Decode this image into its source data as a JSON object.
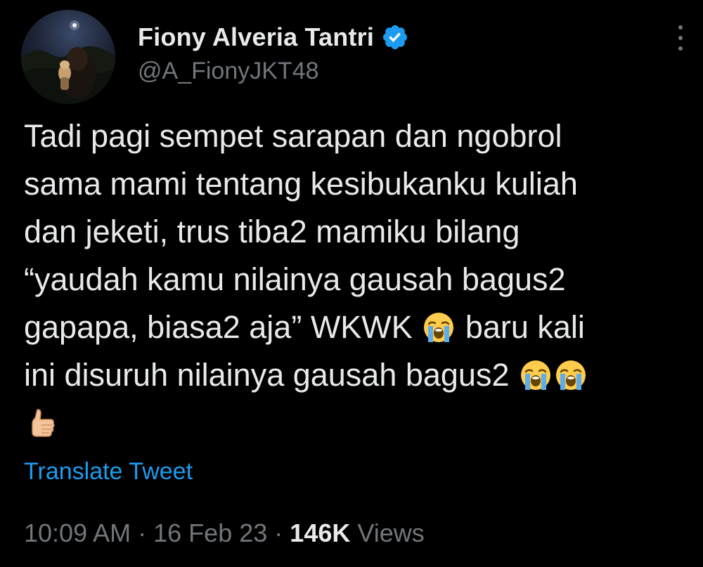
{
  "author": {
    "display_name": "Fiony Alveria Tantri",
    "handle": "@A_FionyJKT48",
    "verified_icon": "verified-badge-icon",
    "avatar_icon": "avatar-photo"
  },
  "tweet": {
    "lines": [
      "Tadi pagi sempet sarapan dan ngobrol",
      "sama mami tentang kesibukanku kuliah",
      "dan jeketi, trus tiba2 mamiku bilang",
      "“yaudah kamu nilainya gausah bagus2",
      "gapapa, biasa2 aja” WKWK",
      " baru kali",
      "ini disuruh nilainya gausah bagus2"
    ],
    "emojis": [
      "loudly-crying-face",
      "loudly-crying-face",
      "loudly-crying-face",
      "thumbs-up"
    ]
  },
  "translate_label": "Translate Tweet",
  "meta": {
    "time": "10:09 AM",
    "separator": "·",
    "date": "16 Feb 23",
    "views_count": "146K",
    "views_label": "Views"
  },
  "colors": {
    "background": "#000000",
    "text": "#e7e9ea",
    "muted": "#71767b",
    "link": "#1d9bf0"
  }
}
